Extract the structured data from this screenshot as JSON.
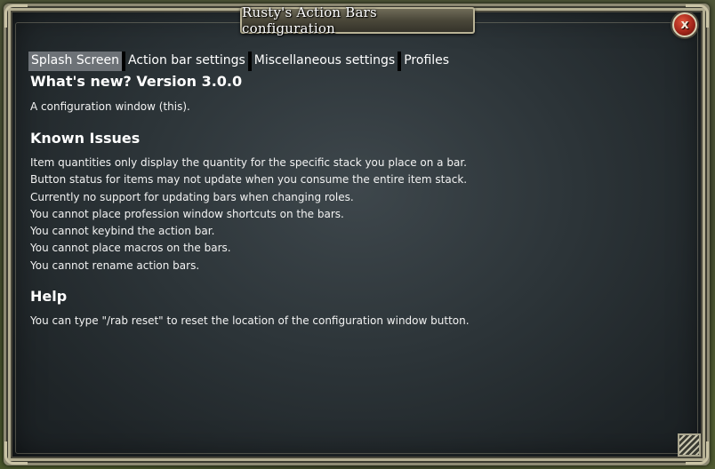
{
  "window": {
    "title": "Rusty's Action Bars configuration",
    "close_label": "x"
  },
  "tabs": [
    {
      "label": "Splash Screen",
      "active": true
    },
    {
      "label": "Action bar settings",
      "active": false
    },
    {
      "label": "Miscellaneous settings",
      "active": false
    },
    {
      "label": "Profiles",
      "active": false
    }
  ],
  "splash": {
    "whats_new_heading": "What's new? Version 3.0.0",
    "whats_new_text": "A configuration window (this).",
    "known_issues_heading": "Known Issues",
    "known_issues": [
      "Item quantities only display the quantity for the specific stack you place on a bar.",
      "Button status for items may not update when you consume the entire item stack.",
      "Currently no support for updating bars when changing roles.",
      "You cannot place profession window shortcuts on the bars.",
      "You cannot keybind the action bar.",
      "You cannot place macros on the bars.",
      "You cannot rename action bars."
    ],
    "help_heading": "Help",
    "help_text": "You can type \"/rab reset\" to reset the location of the configuration window button."
  },
  "colors": {
    "active_tab_bg": "#6d7277",
    "close_button": "#a4261a",
    "frame_border": "#b3ae92"
  }
}
